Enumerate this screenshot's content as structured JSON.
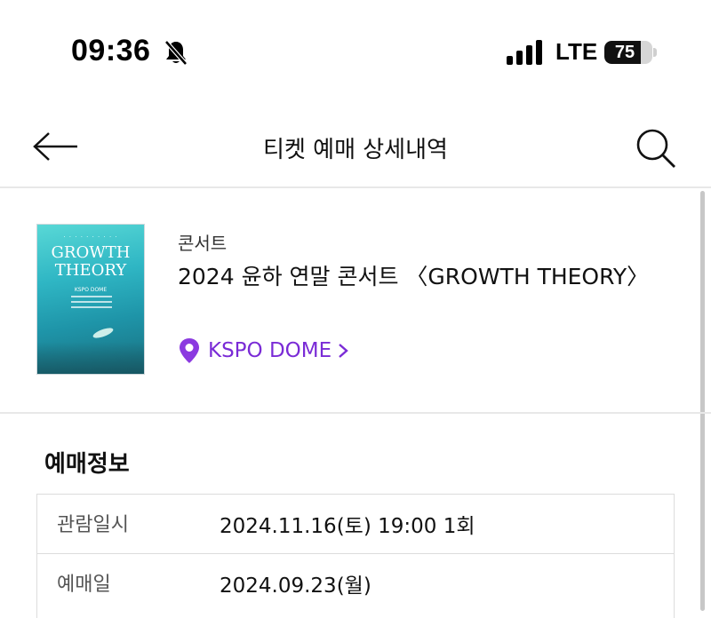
{
  "status_bar": {
    "time": "09:36",
    "network": "LTE",
    "battery_level": "75",
    "battery_fraction": 0.75
  },
  "header": {
    "title": "티켓 예매 상세내역"
  },
  "event": {
    "category": "콘서트",
    "title": "2024 윤하 연말 콘서트 〈GROWTH THEORY〉",
    "venue": "KSPO DOME",
    "poster": {
      "title_line1": "GROWTH",
      "title_line2": "THEORY",
      "venue": "KSPO DOME"
    }
  },
  "booking_info": {
    "section_title": "예매정보",
    "rows": [
      {
        "label": "관람일시",
        "value": "2024.11.16(토) 19:00 1회"
      },
      {
        "label": "예매일",
        "value": "2024.09.23(월)"
      }
    ]
  },
  "colors": {
    "accent": "#7a2bd6",
    "divider": "#e8e8e8"
  },
  "icons": {
    "back": "arrow-left-icon",
    "search": "search-icon",
    "venue": "location-pin-icon",
    "venue_link": "chevron-right-icon",
    "mute": "bell-slash-icon"
  }
}
